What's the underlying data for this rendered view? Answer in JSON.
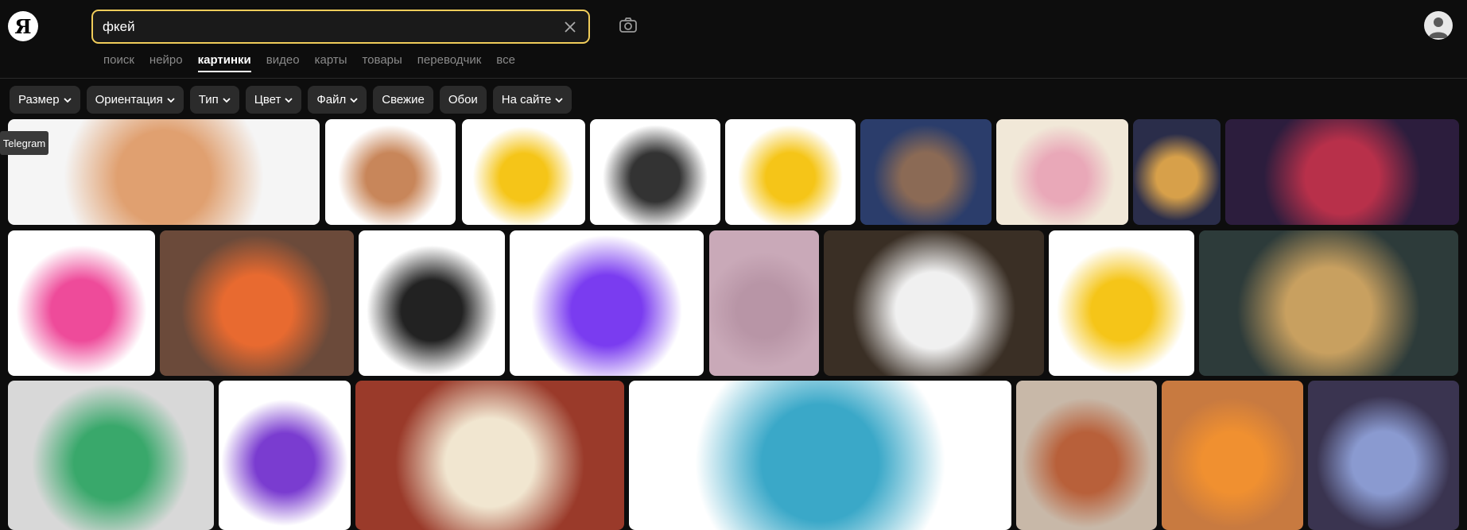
{
  "brand": {
    "logo_letter": "Я"
  },
  "search": {
    "value": "фкей",
    "placeholder": ""
  },
  "nav": {
    "items": [
      "поиск",
      "нейро",
      "картинки",
      "видео",
      "карты",
      "товары",
      "переводчик",
      "все"
    ],
    "active_index": 2
  },
  "filters": [
    {
      "label": "Размер",
      "dropdown": true
    },
    {
      "label": "Ориентация",
      "dropdown": true
    },
    {
      "label": "Тип",
      "dropdown": true
    },
    {
      "label": "Цвет",
      "dropdown": true
    },
    {
      "label": "Файл",
      "dropdown": true
    },
    {
      "label": "Свежие",
      "dropdown": false
    },
    {
      "label": "Обои",
      "dropdown": false
    },
    {
      "label": "На сайте",
      "dropdown": true
    }
  ],
  "tooltip": {
    "text": "Telegram"
  },
  "thumbnails": [
    {
      "desc": "facepalm emoji skin tones",
      "bg": "#f5f5f5",
      "accent": "#e0a070"
    },
    {
      "desc": "facepalm emoji woman",
      "bg": "#ffffff",
      "accent": "#c8865a"
    },
    {
      "desc": "yellow smiley hand",
      "bg": "#ffffff",
      "accent": "#f5c518"
    },
    {
      "desc": "girl circle frame",
      "bg": "#ffffff",
      "accent": "#333333"
    },
    {
      "desc": "yellow hand gesture",
      "bg": "#ffffff",
      "accent": "#f5c518"
    },
    {
      "desc": "wrestler crowd",
      "bg": "#2b3d6b",
      "accent": "#8b6a55"
    },
    {
      "desc": "anime kiss",
      "bg": "#f1e8d8",
      "accent": "#e9a8b8"
    },
    {
      "desc": "lake landscape",
      "bg": "#2a2d4a",
      "accent": "#d7a04a"
    },
    {
      "desc": "dark red forest",
      "bg": "#2c1d3d",
      "accent": "#b8304a"
    },
    {
      "desc": "facepalm girl cartoon",
      "bg": "#ffffff",
      "accent": "#ee4b9a"
    },
    {
      "desc": "graffiti wall",
      "bg": "#6b4a3a",
      "accent": "#e86a30"
    },
    {
      "desc": "man hat comic",
      "bg": "#ffffff",
      "accent": "#222222"
    },
    {
      "desc": "facepalm girl purple",
      "bg": "#ffffff",
      "accent": "#7a3cf0"
    },
    {
      "desc": "blurred",
      "bg": "#c9a9b8",
      "accent": "#b895a6"
    },
    {
      "desc": "laughing cat",
      "bg": "#3a2f25",
      "accent": "#f0f0f0"
    },
    {
      "desc": "facepalm emoji yellow",
      "bg": "#ffffff",
      "accent": "#f5c518"
    },
    {
      "desc": "fantasy warrior",
      "bg": "#2d3b3a",
      "accent": "#c8a060"
    },
    {
      "desc": "graffiti green",
      "bg": "#d8d8d8",
      "accent": "#39a86b"
    },
    {
      "desc": "memoji purple hair",
      "bg": "#ffffff",
      "accent": "#7a3cd0"
    },
    {
      "desc": "game item sets",
      "bg": "#9a3a2a",
      "accent": "#f1e6d0"
    },
    {
      "desc": "fairies banner",
      "bg": "#ffffff",
      "accent": "#3aa8c8"
    },
    {
      "desc": "boy glasses photo",
      "bg": "#c8b8a8",
      "accent": "#b8603a"
    },
    {
      "desc": "boy glasses cartoon",
      "bg": "#c87a40",
      "accent": "#f09030"
    },
    {
      "desc": "anime group",
      "bg": "#3a3450",
      "accent": "#8a9ad0"
    }
  ]
}
